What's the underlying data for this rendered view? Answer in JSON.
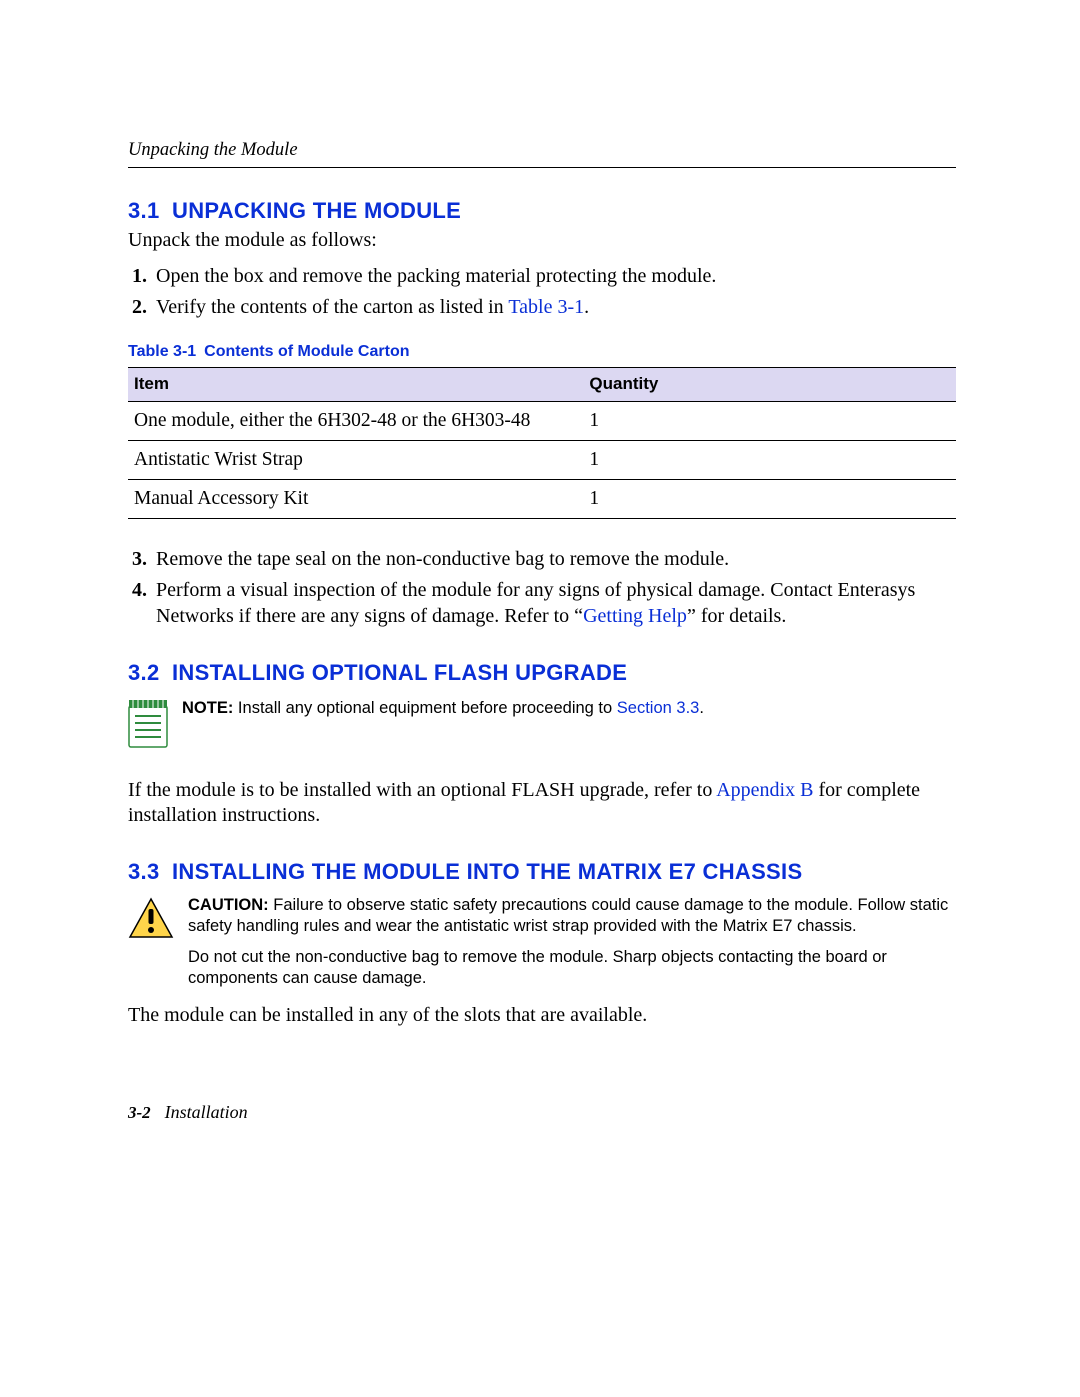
{
  "running_header": "Unpacking the Module",
  "sections": {
    "s1": {
      "num": "3.1",
      "title": "UNPACKING THE MODULE"
    },
    "s2": {
      "num": "3.2",
      "title": "INSTALLING OPTIONAL FLASH UPGRADE"
    },
    "s3": {
      "num": "3.3",
      "title": "INSTALLING THE MODULE INTO THE MATRIX E7 CHASSIS"
    }
  },
  "s1_intro": "Unpack the module as follows:",
  "s1_steps_a": {
    "1": {
      "n": "1.",
      "text": "Open the box and remove the packing material protecting the module."
    },
    "2": {
      "n": "2.",
      "prefix": "Verify the contents of the carton as listed in ",
      "link": "Table 3-1",
      "suffix": "."
    }
  },
  "table": {
    "label": "Table 3-1",
    "title": "Contents of Module Carton",
    "headers": {
      "item": "Item",
      "qty": "Quantity"
    },
    "rows": {
      "r1": {
        "item": "One module, either the 6H302-48 or the 6H303-48",
        "qty": "1"
      },
      "r2": {
        "item": "Antistatic Wrist Strap",
        "qty": "1"
      },
      "r3": {
        "item": "Manual Accessory Kit",
        "qty": "1"
      }
    }
  },
  "s1_steps_b": {
    "3": {
      "n": "3.",
      "text": "Remove the tape seal on the non-conductive bag to remove the module."
    },
    "4": {
      "n": "4.",
      "prefix": "Perform a visual inspection of the module for any signs of physical damage. Contact Enterasys Networks if there are any signs of damage. Refer to “",
      "link": "Getting Help",
      "suffix": "” for details."
    }
  },
  "note": {
    "lead": "NOTE:",
    "prefix": "  Install any optional equipment before proceeding to ",
    "link": "Section 3.3",
    "suffix": "."
  },
  "s2_para": {
    "prefix": "If the module is to be installed with an optional FLASH upgrade, refer to ",
    "link": "Appendix B",
    "suffix": " for complete installation instructions."
  },
  "caution": {
    "lead": "CAUTION:",
    "para1": "  Failure to observe static safety precautions could cause damage to the module. Follow static safety handling rules and wear the antistatic wrist strap provided with the Matrix E7 chassis.",
    "para2": "Do not cut the non-conductive bag to remove the module. Sharp objects contacting the board or components can cause damage."
  },
  "s3_para": "The module can be installed in any of the slots that are available.",
  "footer": {
    "page": "3-2",
    "chapter": "Installation"
  }
}
